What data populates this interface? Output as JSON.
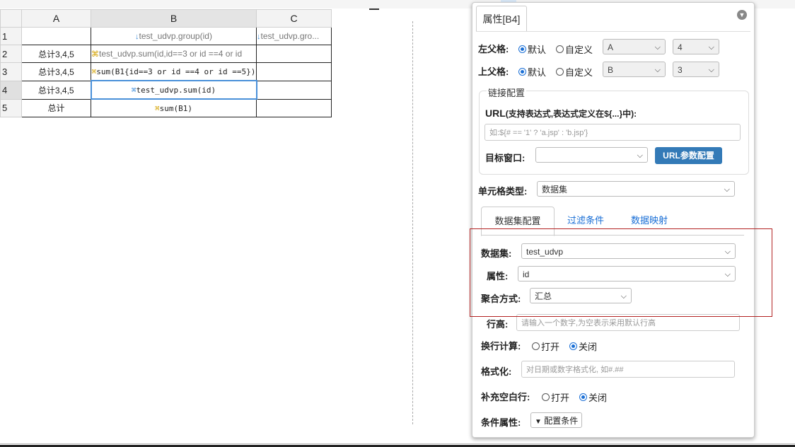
{
  "spreadsheet": {
    "columns": [
      "A",
      "B",
      "C"
    ],
    "rows": [
      {
        "num": "1",
        "a": "",
        "b": "test_udvp.group(id)",
        "c": "test_udvp.gro..."
      },
      {
        "num": "2",
        "a": "总计3,4,5",
        "b": "test_udvp.sum(id,id==3 or id ==4 or id",
        "c": ""
      },
      {
        "num": "3",
        "a": "总计3,4,5",
        "b": "sum(B1{id==3 or id ==4 or id ==5})",
        "c": ""
      },
      {
        "num": "4",
        "a": "总计3,4,5",
        "b": "test_udvp.sum(id)",
        "c": ""
      },
      {
        "num": "5",
        "a": "总计",
        "b": "sum(B1)",
        "c": ""
      }
    ]
  },
  "panel": {
    "tab_title": "属性[B4]",
    "left_parent": {
      "label": "左父格:",
      "default_label": "默认",
      "custom_label": "自定义",
      "col_value": "A",
      "row_value": "4"
    },
    "top_parent": {
      "label": "上父格:",
      "default_label": "默认",
      "custom_label": "自定义",
      "col_value": "B",
      "row_value": "3"
    },
    "link_config": {
      "legend": "链接配置",
      "url_label": "URL",
      "url_hint": "(支持表达式,表达式定义在${...}中):",
      "url_placeholder": "如:${# == '1' ? 'a.jsp' : 'b.jsp'}",
      "target_label": "目标窗口:",
      "target_value": "",
      "url_param_button": "URL参数配置"
    },
    "cell_type": {
      "label": "单元格类型:",
      "value": "数据集"
    },
    "subtabs": [
      "数据集配置",
      "过滤条件",
      "数据映射"
    ],
    "dataset": {
      "label": "数据集:",
      "value": "test_udvp"
    },
    "property": {
      "label": "属性:",
      "value": "id"
    },
    "aggregate": {
      "label": "聚合方式:",
      "value": "汇总"
    },
    "row_height": {
      "label": "行高:",
      "placeholder": "请输入一个数字,为空表示采用默认行高"
    },
    "wrap_calc": {
      "label": "换行计算:",
      "open_label": "打开",
      "close_label": "关闭"
    },
    "format": {
      "label": "格式化:",
      "placeholder": "对日期或数字格式化, 如#.##"
    },
    "fill_blank": {
      "label": "补充空白行:",
      "open_label": "打开",
      "close_label": "关闭"
    },
    "condition": {
      "label": "条件属性:",
      "button": "配置条件"
    }
  },
  "colors": {
    "accent": "#1a6fd6",
    "button_blue": "#337ab7",
    "highlight": "#b22222",
    "selection": "#4a90d9"
  }
}
